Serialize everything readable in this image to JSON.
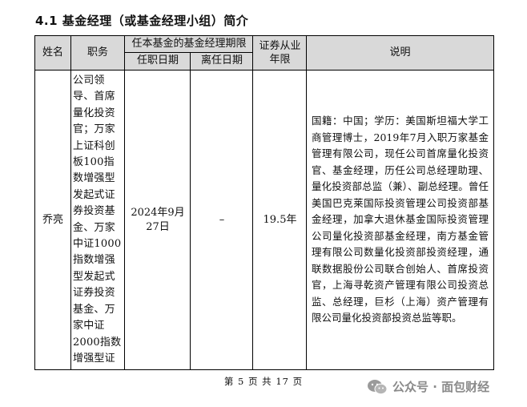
{
  "section_title": "4.1 基金经理（或基金经理小组）简介",
  "table": {
    "headers": {
      "name": "姓名",
      "duty": "职务",
      "term_group": "任本基金的基金经理期限",
      "start_date": "任职日期",
      "end_date": "离任日期",
      "years": "证券从业年限",
      "description": "说明"
    },
    "row": {
      "name": "乔亮",
      "duty": "公司领导、首席量化投资官；万家上证科创板100指数增强型发起式证券投资基金、万家中证1000指数增强型发起式证券投资基金、万家中证2000指数增强型证",
      "start_date": "2024年9月27日",
      "end_date": "–",
      "years": "19.5年",
      "description": "国籍：中国；学历：美国斯坦福大学工商管理博士，2019年7月入职万家基金管理有限公司，现任公司首席量化投资官、基金经理，历任公司总经理助理、量化投资部总监（兼）、副总经理。曾任美国巴克莱国际投资管理公司投资部基金经理，加拿大退休基金国际投资管理公司量化投资部基金经理，南方基金管理有限公司数量化投资部投资经理，通联数据股份公司联合创始人、首席投资官，上海寻乾资产管理有限公司投资总监、总经理，巨杉（上海）资产管理有限公司量化投资部投资总监等职。"
    }
  },
  "footer": "第 5 页 共 17 页",
  "watermark": {
    "text": "公众号 · 面包财经",
    "icon": "wechat-icon"
  }
}
